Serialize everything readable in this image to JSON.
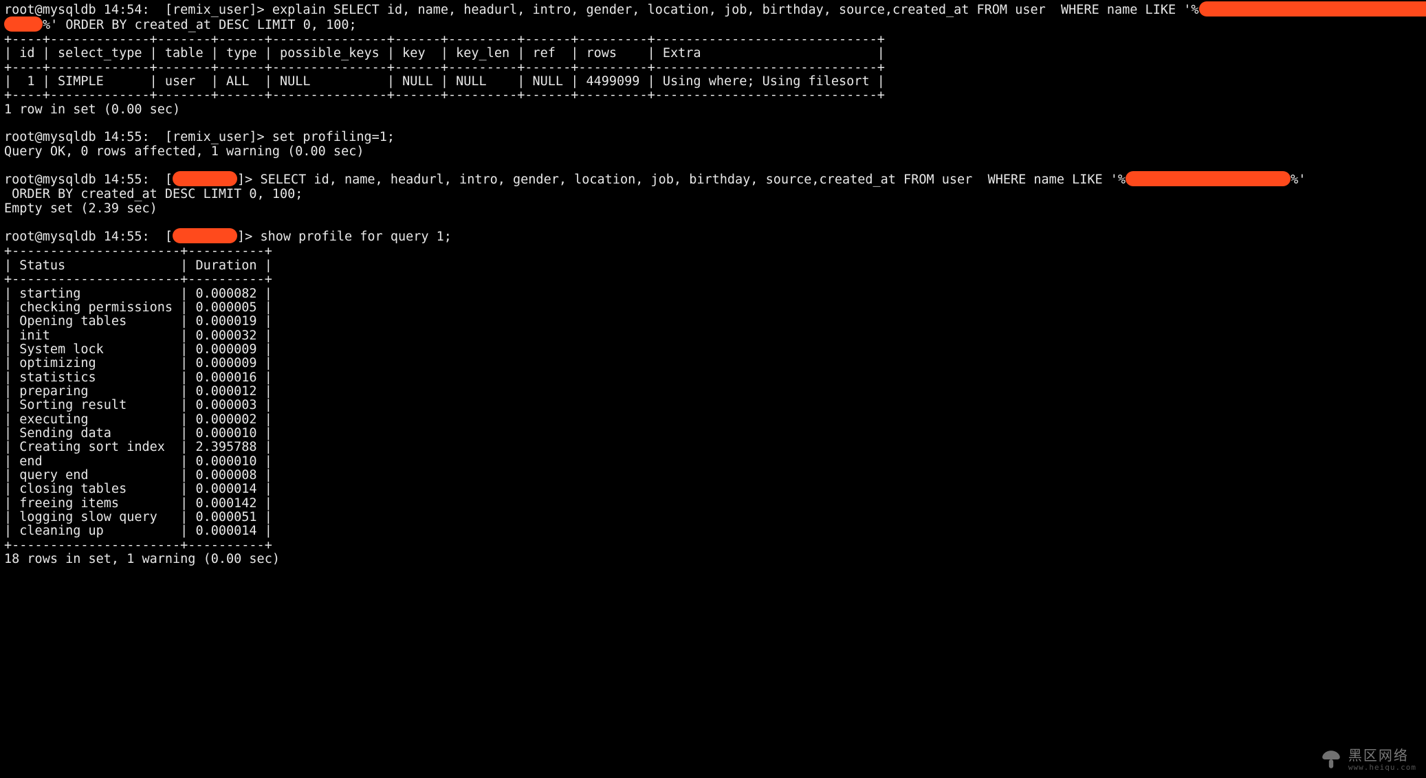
{
  "prompts": {
    "p1_prefix": "root@mysqldb 14:54:  [remix_user]> ",
    "p2_prefix": "root@mysqldb 14:55:  [remix_user]> ",
    "p3_prefix": "root@mysqldb 14:55:  [",
    "p3_mid": "]> ",
    "p4_prefix": "root@mysqldb 14:55:  [",
    "p4_mid": "]> "
  },
  "commands": {
    "explain_part1": "explain SELECT id, name, headurl, intro, gender, location, job, birthday, source,created_at FROM user  WHERE name LIKE '%",
    "explain_part2_prefix": "",
    "explain_part2_suffix": "%' ORDER BY created_at DESC LIMIT 0, 100;",
    "set_profiling": "set profiling=1;",
    "select_part1": "SELECT id, name, headurl, intro, gender, location, job, birthday, source,created_at FROM user  WHERE name LIKE '%",
    "select_part2_suffix": "%'",
    "select_cont": " ORDER BY created_at DESC LIMIT 0, 100;",
    "show_profile": "show profile for query 1;"
  },
  "explain_table": {
    "border": "+----+-------------+-------+------+---------------+------+---------+------+---------+-----------------------------+",
    "header": "| id | select_type | table | type | possible_keys | key  | key_len | ref  | rows    | Extra                       |",
    "row": "|  1 | SIMPLE      | user  | ALL  | NULL          | NULL | NULL    | NULL | 4499099 | Using where; Using filesort |",
    "footer": "1 row in set (0.00 sec)"
  },
  "responses": {
    "query_ok": "Query OK, 0 rows affected, 1 warning (0.00 sec)",
    "empty_set": "Empty set (2.39 sec)",
    "profile_footer": "18 rows in set, 1 warning (0.00 sec)"
  },
  "profile_table": {
    "border": "+----------------------+----------+",
    "header": "| Status               | Duration |",
    "rows": [
      "| starting             | 0.000082 |",
      "| checking permissions | 0.000005 |",
      "| Opening tables       | 0.000019 |",
      "| init                 | 0.000032 |",
      "| System lock          | 0.000009 |",
      "| optimizing           | 0.000009 |",
      "| statistics           | 0.000016 |",
      "| preparing            | 0.000012 |",
      "| Sorting result       | 0.000003 |",
      "| executing            | 0.000002 |",
      "| Sending data         | 0.000010 |",
      "| Creating sort index  | 2.395788 |",
      "| end                  | 0.000010 |",
      "| query end            | 0.000008 |",
      "| closing tables       | 0.000014 |",
      "| freeing items        | 0.000142 |",
      "| logging slow query   | 0.000051 |",
      "| cleaning up          | 0.000014 |"
    ]
  },
  "watermark": {
    "cn": "黑区网络",
    "en": "www.heiqu.com"
  }
}
